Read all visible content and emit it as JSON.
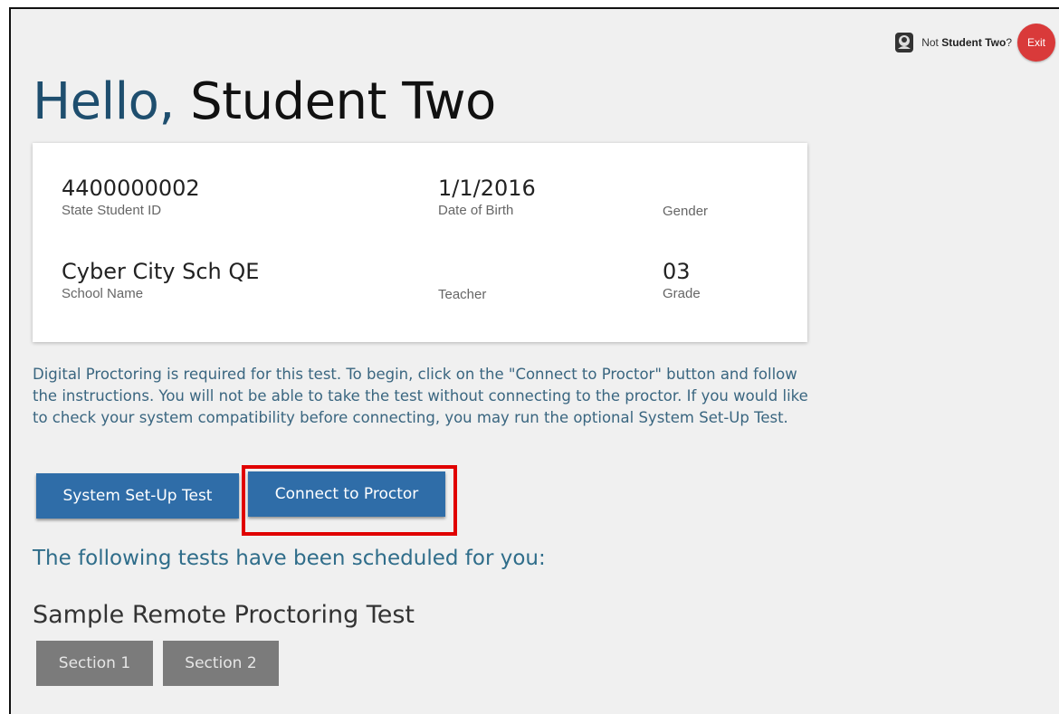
{
  "topbar": {
    "not_prefix": "Not ",
    "user_name": "Student Two",
    "not_suffix": "?",
    "exit_label": "Exit",
    "user_icon": "user-id-icon"
  },
  "greeting": {
    "hello": "Hello,",
    "name": "Student Two"
  },
  "student_card": {
    "state_student_id": {
      "value": "4400000002",
      "label": "State Student ID"
    },
    "date_of_birth": {
      "value": "1/1/2016",
      "label": "Date of Birth"
    },
    "gender": {
      "value": "",
      "label": "Gender"
    },
    "school_name": {
      "value": "Cyber City Sch QE",
      "label": "School Name"
    },
    "teacher": {
      "value": "",
      "label": "Teacher"
    },
    "grade": {
      "value": "03",
      "label": "Grade"
    }
  },
  "instructions": "Digital Proctoring is required for this test. To begin, click on the \"Connect to Proctor\" button and follow the instructions. You will not be able to take the test without connecting to the proctor. If you would like to check your system compatibility before connecting, you may run the optional System Set-Up Test.",
  "actions": {
    "system_setup_label": "System Set-Up Test",
    "connect_label": "Connect to Proctor"
  },
  "scheduled_heading": "The following tests have been scheduled for you:",
  "test": {
    "name": "Sample Remote Proctoring Test",
    "sections": [
      "Section 1",
      "Section 2"
    ]
  },
  "colors": {
    "primary_button": "#2f6da8",
    "exit_button": "#d93a3a",
    "highlight": "#e00000",
    "section_button": "#7b7b7b"
  }
}
